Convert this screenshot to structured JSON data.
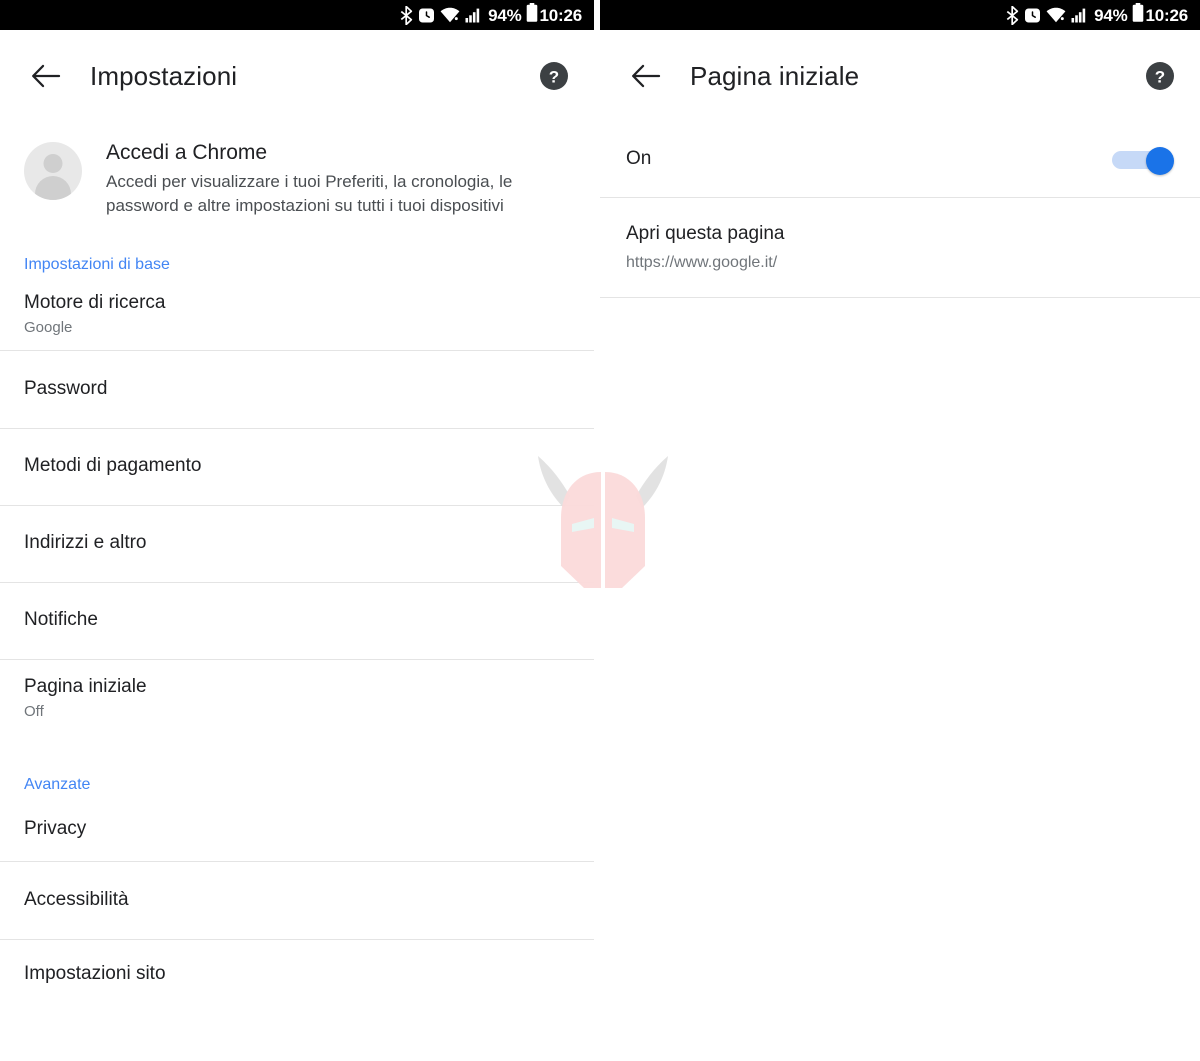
{
  "statusbar": {
    "battery_percent": "94%",
    "time": "10:26",
    "icons": [
      "bluetooth-icon",
      "alarm-icon",
      "wifi-icon",
      "signal-icon",
      "battery-icon"
    ]
  },
  "left_screen": {
    "appbar": {
      "title": "Impostazioni",
      "back_icon": "back-arrow-icon",
      "help_icon": "help-icon"
    },
    "account": {
      "avatar_icon": "account-avatar-icon",
      "title": "Accedi a Chrome",
      "subtitle": "Accedi per visualizzare i tuoi Preferiti, la cronologia, le password e altre impostazioni su tutti i tuoi dispositivi"
    },
    "section_basic": "Impostazioni di base",
    "section_advanced": "Avanzate",
    "items": [
      {
        "title": "Motore di ricerca",
        "subtitle": "Google"
      },
      {
        "title": "Password",
        "subtitle": ""
      },
      {
        "title": "Metodi di pagamento",
        "subtitle": ""
      },
      {
        "title": "Indirizzi e altro",
        "subtitle": ""
      },
      {
        "title": "Notifiche",
        "subtitle": ""
      },
      {
        "title": "Pagina iniziale",
        "subtitle": "Off"
      },
      {
        "title": "Privacy",
        "subtitle": ""
      },
      {
        "title": "Accessibilità",
        "subtitle": ""
      },
      {
        "title": "Impostazioni sito",
        "subtitle": ""
      }
    ]
  },
  "right_screen": {
    "appbar": {
      "title": "Pagina iniziale",
      "back_icon": "back-arrow-icon",
      "help_icon": "help-icon"
    },
    "toggle_row": {
      "label": "On",
      "toggle_state": "on"
    },
    "page_row": {
      "title": "Apri questa pagina",
      "url": "https://www.google.it/"
    }
  },
  "colors": {
    "accent_blue": "#4285f4",
    "toggle_blue": "#1a73e8",
    "text_primary": "#202124",
    "text_secondary": "#70757a",
    "divider": "#e4e4e4",
    "statusbar_bg": "#000000"
  },
  "watermark": {
    "icon": "viking-helmet-watermark"
  }
}
